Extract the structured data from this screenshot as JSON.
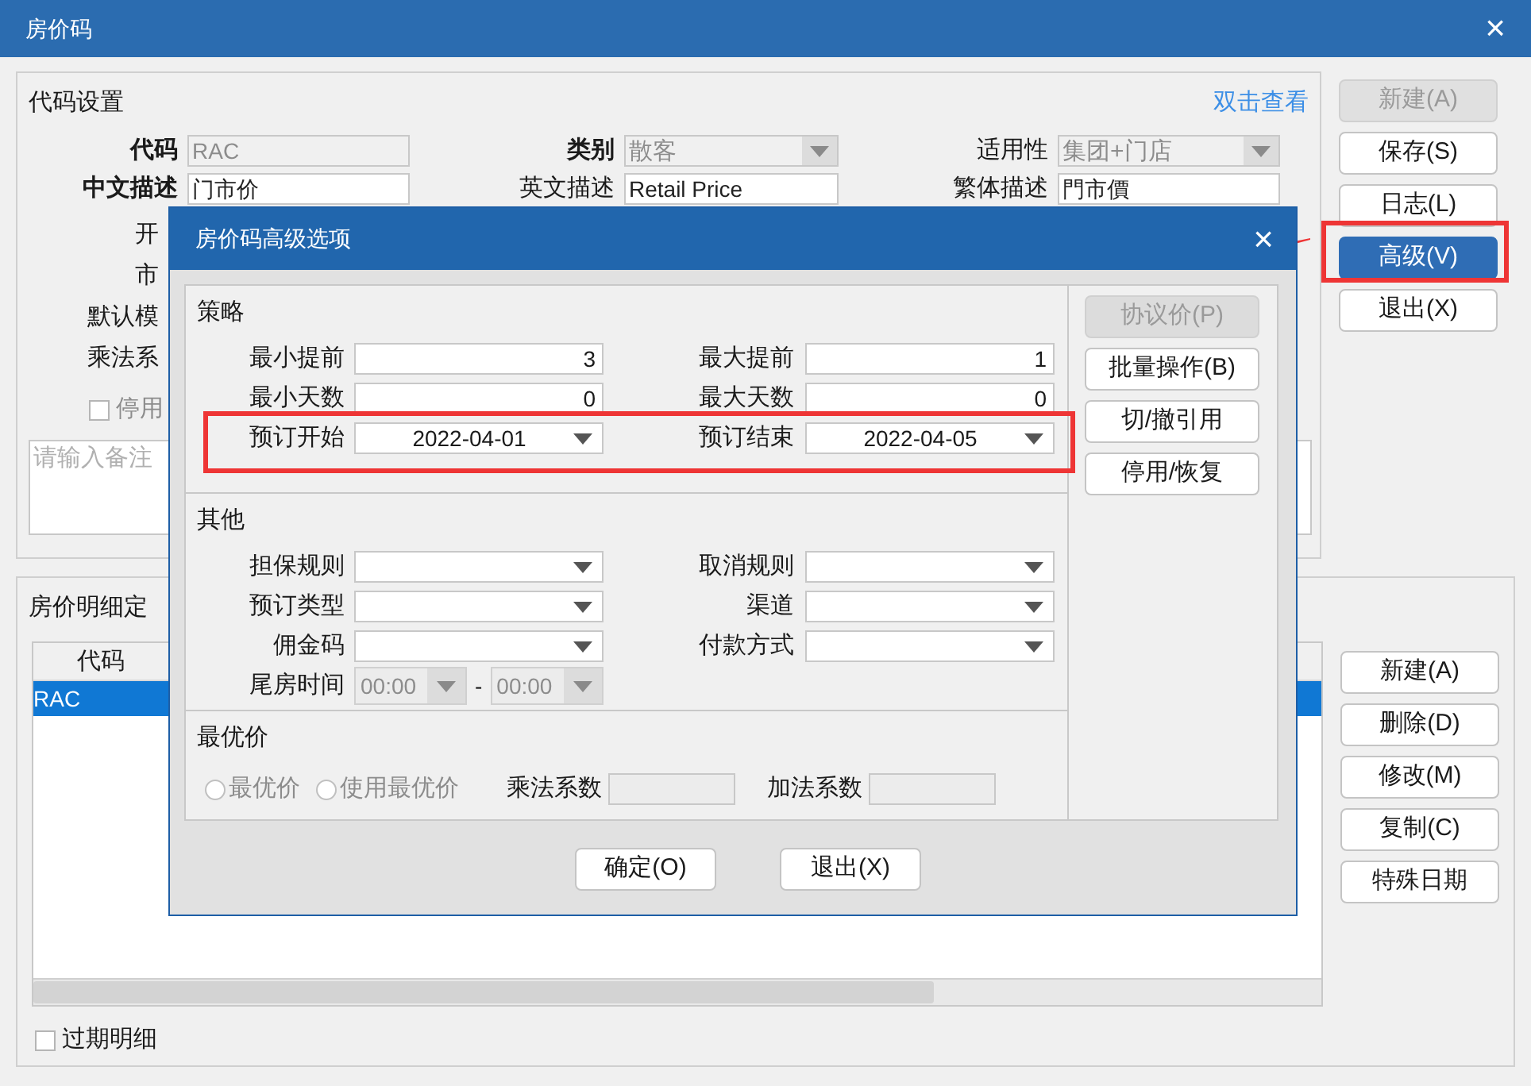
{
  "window": {
    "title": "房价码",
    "close": "×"
  },
  "code_settings": {
    "title": "代码设置",
    "link": "双击查看",
    "row1": [
      {
        "label": "代码",
        "value": "RAC",
        "kind": "text",
        "required": true,
        "disabled": true
      },
      {
        "label": "类别",
        "value": "散客",
        "kind": "dropdown",
        "required": true,
        "disabled": true
      },
      {
        "label": "适用性",
        "value": "集团+门店",
        "kind": "dropdown",
        "required": false,
        "disabled": true
      }
    ],
    "row2": [
      {
        "label": "中文描述",
        "value": "门市价",
        "kind": "text",
        "required": true,
        "disabled": false
      },
      {
        "label": "英文描述",
        "value": "Retail Price",
        "kind": "text",
        "required": false,
        "disabled": false
      },
      {
        "label": "繁体描述",
        "value": "門市價",
        "kind": "text",
        "required": false,
        "disabled": false
      }
    ],
    "cut_labels": [
      "开",
      "市",
      "默认模",
      "乘法系"
    ],
    "disable_checkbox": {
      "label": "停用",
      "checked": false
    },
    "remark": {
      "placeholder": "请输入备注"
    }
  },
  "top_buttons": [
    {
      "label": "新建(A)",
      "disabled": true,
      "selected": false,
      "highlighted": false
    },
    {
      "label": "保存(S)",
      "disabled": false,
      "selected": false,
      "highlighted": false
    },
    {
      "label": "日志(L)",
      "disabled": false,
      "selected": false,
      "highlighted": false
    },
    {
      "label": "高级(V)",
      "disabled": false,
      "selected": true,
      "highlighted": true
    },
    {
      "label": "退出(X)",
      "disabled": false,
      "selected": false,
      "highlighted": false
    }
  ],
  "detail": {
    "title": "房价明细定",
    "table": {
      "columns": [
        "代码"
      ],
      "rows": [
        {
          "cells": [
            "RAC"
          ],
          "selected": true
        }
      ]
    },
    "expired_checkbox": {
      "label": "过期明细",
      "checked": false
    }
  },
  "detail_buttons": [
    "新建(A)",
    "删除(D)",
    "修改(M)",
    "复制(C)",
    "特殊日期"
  ],
  "dialog": {
    "title": "房价码高级选项",
    "close": "×",
    "sections": [
      {
        "title": "策略",
        "kind": "grid",
        "rows": [
          {
            "highlighted": false,
            "fields": [
              {
                "label": "最小提前",
                "kind": "number",
                "value": "3",
                "disabled": false
              },
              {
                "label": "最大提前",
                "kind": "number",
                "value": "1",
                "disabled": false
              }
            ]
          },
          {
            "highlighted": false,
            "fields": [
              {
                "label": "最小天数",
                "kind": "number",
                "value": "0",
                "disabled": false
              },
              {
                "label": "最大天数",
                "kind": "number",
                "value": "0",
                "disabled": false
              }
            ]
          },
          {
            "highlighted": true,
            "fields": [
              {
                "label": "预订开始",
                "kind": "dropdown",
                "value": "2022-04-01",
                "disabled": false
              },
              {
                "label": "预订结束",
                "kind": "dropdown",
                "value": "2022-04-05",
                "disabled": false
              }
            ]
          }
        ]
      },
      {
        "title": "其他",
        "kind": "grid",
        "rows": [
          {
            "highlighted": false,
            "fields": [
              {
                "label": "担保规则",
                "kind": "dropdown",
                "disabled": false
              },
              {
                "label": "取消规则",
                "kind": "dropdown",
                "disabled": false
              }
            ]
          },
          {
            "highlighted": false,
            "fields": [
              {
                "label": "预订类型",
                "kind": "dropdown",
                "disabled": false
              },
              {
                "label": "渠道",
                "kind": "dropdown",
                "disabled": false
              }
            ]
          },
          {
            "highlighted": false,
            "fields": [
              {
                "label": "佣金码",
                "kind": "dropdown",
                "disabled": false
              },
              {
                "label": "付款方式",
                "kind": "dropdown",
                "disabled": false
              }
            ]
          },
          {
            "highlighted": false,
            "fields": [
              {
                "label": "尾房时间",
                "kind": "time_range",
                "from": "00:00",
                "separator": "-",
                "to": "00:00",
                "disabled": true
              }
            ]
          }
        ]
      },
      {
        "title": "最优价",
        "kind": "inline",
        "rows": [
          {
            "highlighted": false,
            "fields": [
              {
                "label": "最优价",
                "kind": "radio",
                "selected": false,
                "disabled": true
              },
              {
                "label": "使用最优价",
                "kind": "radio",
                "selected": false,
                "disabled": true
              },
              {
                "label": "乘法系数",
                "kind": "small_number",
                "disabled": true
              },
              {
                "label": "加法系数",
                "kind": "small_number",
                "disabled": true
              }
            ]
          }
        ]
      }
    ],
    "side_buttons": [
      {
        "label": "协议价(P)",
        "disabled": true
      },
      {
        "label": "批量操作(B)",
        "disabled": false
      },
      {
        "label": "切/撤引用",
        "disabled": false
      },
      {
        "label": "停用/恢复",
        "disabled": false
      }
    ],
    "buttons": [
      "确定(O)",
      "退出(X)"
    ]
  }
}
